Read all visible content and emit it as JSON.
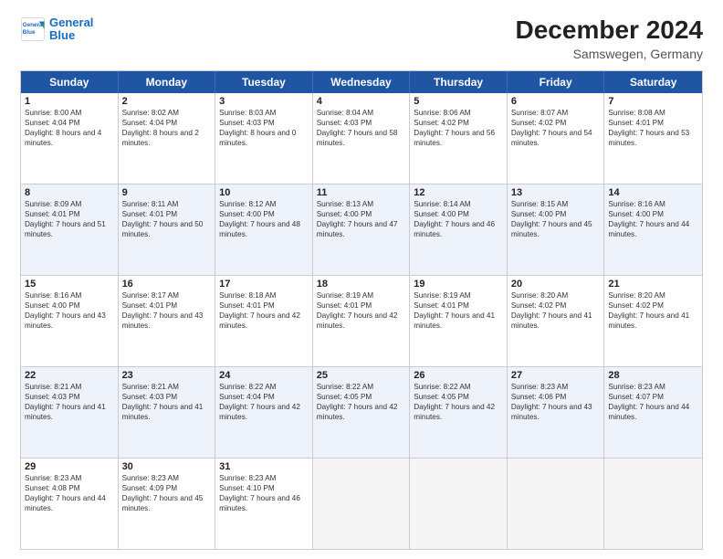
{
  "header": {
    "logo_line1": "General",
    "logo_line2": "Blue",
    "month": "December 2024",
    "location": "Samswegen, Germany"
  },
  "weekdays": [
    "Sunday",
    "Monday",
    "Tuesday",
    "Wednesday",
    "Thursday",
    "Friday",
    "Saturday"
  ],
  "rows": [
    [
      {
        "day": "1",
        "sunrise": "8:00 AM",
        "sunset": "4:04 PM",
        "daylight": "8 hours and 4 minutes."
      },
      {
        "day": "2",
        "sunrise": "8:02 AM",
        "sunset": "4:04 PM",
        "daylight": "8 hours and 2 minutes."
      },
      {
        "day": "3",
        "sunrise": "8:03 AM",
        "sunset": "4:03 PM",
        "daylight": "8 hours and 0 minutes."
      },
      {
        "day": "4",
        "sunrise": "8:04 AM",
        "sunset": "4:03 PM",
        "daylight": "7 hours and 58 minutes."
      },
      {
        "day": "5",
        "sunrise": "8:06 AM",
        "sunset": "4:02 PM",
        "daylight": "7 hours and 56 minutes."
      },
      {
        "day": "6",
        "sunrise": "8:07 AM",
        "sunset": "4:02 PM",
        "daylight": "7 hours and 54 minutes."
      },
      {
        "day": "7",
        "sunrise": "8:08 AM",
        "sunset": "4:01 PM",
        "daylight": "7 hours and 53 minutes."
      }
    ],
    [
      {
        "day": "8",
        "sunrise": "8:09 AM",
        "sunset": "4:01 PM",
        "daylight": "7 hours and 51 minutes."
      },
      {
        "day": "9",
        "sunrise": "8:11 AM",
        "sunset": "4:01 PM",
        "daylight": "7 hours and 50 minutes."
      },
      {
        "day": "10",
        "sunrise": "8:12 AM",
        "sunset": "4:00 PM",
        "daylight": "7 hours and 48 minutes."
      },
      {
        "day": "11",
        "sunrise": "8:13 AM",
        "sunset": "4:00 PM",
        "daylight": "7 hours and 47 minutes."
      },
      {
        "day": "12",
        "sunrise": "8:14 AM",
        "sunset": "4:00 PM",
        "daylight": "7 hours and 46 minutes."
      },
      {
        "day": "13",
        "sunrise": "8:15 AM",
        "sunset": "4:00 PM",
        "daylight": "7 hours and 45 minutes."
      },
      {
        "day": "14",
        "sunrise": "8:16 AM",
        "sunset": "4:00 PM",
        "daylight": "7 hours and 44 minutes."
      }
    ],
    [
      {
        "day": "15",
        "sunrise": "8:16 AM",
        "sunset": "4:00 PM",
        "daylight": "7 hours and 43 minutes."
      },
      {
        "day": "16",
        "sunrise": "8:17 AM",
        "sunset": "4:01 PM",
        "daylight": "7 hours and 43 minutes."
      },
      {
        "day": "17",
        "sunrise": "8:18 AM",
        "sunset": "4:01 PM",
        "daylight": "7 hours and 42 minutes."
      },
      {
        "day": "18",
        "sunrise": "8:19 AM",
        "sunset": "4:01 PM",
        "daylight": "7 hours and 42 minutes."
      },
      {
        "day": "19",
        "sunrise": "8:19 AM",
        "sunset": "4:01 PM",
        "daylight": "7 hours and 41 minutes."
      },
      {
        "day": "20",
        "sunrise": "8:20 AM",
        "sunset": "4:02 PM",
        "daylight": "7 hours and 41 minutes."
      },
      {
        "day": "21",
        "sunrise": "8:20 AM",
        "sunset": "4:02 PM",
        "daylight": "7 hours and 41 minutes."
      }
    ],
    [
      {
        "day": "22",
        "sunrise": "8:21 AM",
        "sunset": "4:03 PM",
        "daylight": "7 hours and 41 minutes."
      },
      {
        "day": "23",
        "sunrise": "8:21 AM",
        "sunset": "4:03 PM",
        "daylight": "7 hours and 41 minutes."
      },
      {
        "day": "24",
        "sunrise": "8:22 AM",
        "sunset": "4:04 PM",
        "daylight": "7 hours and 42 minutes."
      },
      {
        "day": "25",
        "sunrise": "8:22 AM",
        "sunset": "4:05 PM",
        "daylight": "7 hours and 42 minutes."
      },
      {
        "day": "26",
        "sunrise": "8:22 AM",
        "sunset": "4:05 PM",
        "daylight": "7 hours and 42 minutes."
      },
      {
        "day": "27",
        "sunrise": "8:23 AM",
        "sunset": "4:06 PM",
        "daylight": "7 hours and 43 minutes."
      },
      {
        "day": "28",
        "sunrise": "8:23 AM",
        "sunset": "4:07 PM",
        "daylight": "7 hours and 44 minutes."
      }
    ],
    [
      {
        "day": "29",
        "sunrise": "8:23 AM",
        "sunset": "4:08 PM",
        "daylight": "7 hours and 44 minutes."
      },
      {
        "day": "30",
        "sunrise": "8:23 AM",
        "sunset": "4:09 PM",
        "daylight": "7 hours and 45 minutes."
      },
      {
        "day": "31",
        "sunrise": "8:23 AM",
        "sunset": "4:10 PM",
        "daylight": "7 hours and 46 minutes."
      },
      null,
      null,
      null,
      null
    ]
  ]
}
